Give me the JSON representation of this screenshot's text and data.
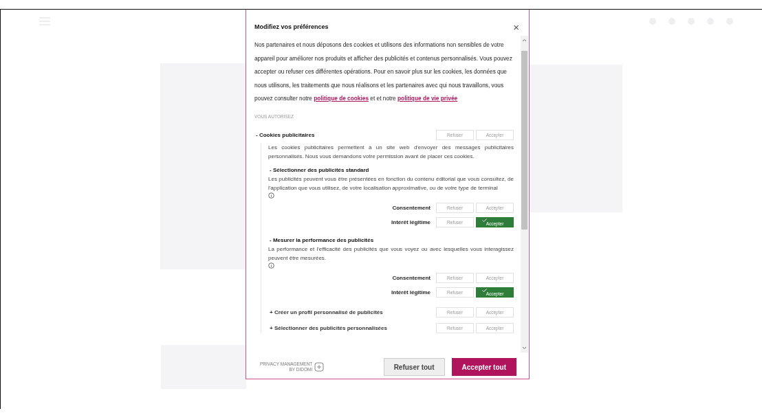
{
  "dialog": {
    "title": "Modifiez vos préférences",
    "close": "×",
    "intro": {
      "text": "Nos partenaires et nous déposons des cookies et utilisons des informations non sensibles de votre appareil pour améliorer nos produits et afficher des publicités et contenus personnalisés. Vous pouvez accepter ou refuser ces différentes opérations. Pour en savoir plus sur les cookies, les données que nous utilisons, les traitements que nous réalisons et les partenaires avec qui nous travaillons, vous pouvez consulter notre",
      "link1": "politique de cookies",
      "middle": "et et notre",
      "link2": "politique de vie privée"
    },
    "section_label": "VOUS AUTORISEZ",
    "purposes": [
      {
        "marker": "-",
        "title": "Cookies publicitaires",
        "expanded": true,
        "options": [
          {
            "label": "Refuser",
            "selected": false
          },
          {
            "label": "Accepter",
            "selected": false
          }
        ],
        "description": "Les cookies publicitaires permettent à un site web d'envoyer des messages publicitaires personnalisés. Nous vous demandons votre permission avant de placer ces cookies.",
        "children": [
          {
            "marker": "-",
            "title": "Sélectionner des publicités standard",
            "expanded": true,
            "description": "Les publicités peuvent vous être présentées en fonction du contenu éditorial que vous consultez, de l'application que vous utilisez, de votre localisation approximative, ou de votre type de terminal",
            "rows": [
              {
                "label": "Consentement",
                "options": [
                  {
                    "label": "Refuser",
                    "selected": false
                  },
                  {
                    "label": "Accepter",
                    "selected": false
                  }
                ]
              },
              {
                "label": "Intérêt légitime",
                "options": [
                  {
                    "label": "Refuser",
                    "selected": false
                  },
                  {
                    "label": "Accepter",
                    "selected": true
                  }
                ]
              }
            ]
          },
          {
            "marker": "-",
            "title": "Mesurer la performance des publicités",
            "expanded": true,
            "description": "La performance et l'efficacité des publicités que vous voyez ou avec lesquelles vous interagissez peuvent être mesurées.",
            "rows": [
              {
                "label": "Consentement",
                "options": [
                  {
                    "label": "Refuser",
                    "selected": false
                  },
                  {
                    "label": "Accepter",
                    "selected": false
                  }
                ]
              },
              {
                "label": "Intérêt légitime",
                "options": [
                  {
                    "label": "Refuser",
                    "selected": false
                  },
                  {
                    "label": "Accepter",
                    "selected": true
                  }
                ]
              }
            ]
          },
          {
            "marker": "+",
            "title": "Créer un profil personnalisé de publicités",
            "expanded": false,
            "options": [
              {
                "label": "Refuser",
                "selected": false
              },
              {
                "label": "Accepter",
                "selected": false
              }
            ]
          },
          {
            "marker": "+",
            "title": "Sélectionner des publicités personnalisées",
            "expanded": false,
            "options": [
              {
                "label": "Refuser",
                "selected": false
              },
              {
                "label": "Accepter",
                "selected": false
              }
            ]
          }
        ]
      }
    ],
    "brand": [
      "PRIVACY MANAGEMENT",
      "BY DIDOMI"
    ],
    "buttons": [
      {
        "label": "Refuser tout",
        "kind": "secondary"
      },
      {
        "label": "Accepter tout",
        "kind": "primary"
      }
    ]
  }
}
